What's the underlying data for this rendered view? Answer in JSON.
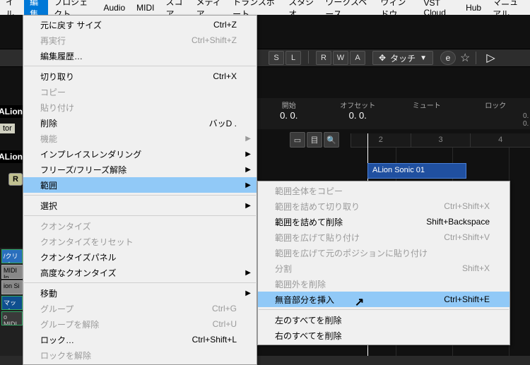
{
  "menubar": {
    "file": "イル",
    "edit": "編集",
    "project": "プロジェクト",
    "audio": "Audio",
    "midi": "MIDI",
    "score": "スコア",
    "media": "メディア",
    "transport": "トランスポート",
    "studio": "スタジオ",
    "workspace": "ワークスペース",
    "window": "ウィンドウ",
    "vstcloud": "VST Cloud",
    "hub": "Hub",
    "manual": "マニュアル"
  },
  "toolbar": {
    "S": "S",
    "L": "L",
    "R": "R",
    "W": "W",
    "A": "A",
    "touch": "タッチ",
    "e_icon": "e",
    "star": "☆"
  },
  "info": {
    "start_lbl": "開始",
    "start_val": "0.  0.",
    "offset_lbl": "オフセット",
    "offset_val": "0.  0.",
    "mute_lbl": "ミュート",
    "mute_val": "",
    "lock_lbl": "ロック",
    "lock_val": "",
    "sub": "0.  0."
  },
  "tracks": {
    "name1": "ALion",
    "tor": "tor",
    "name2": "ALion",
    "r": "R",
    "clip": "ALion Sonic 01"
  },
  "ruler": {
    "t2": "2",
    "t3": "3",
    "t4": "4"
  },
  "icorow": {
    "a": "▭",
    "b": "目",
    "c": "🔍"
  },
  "gutter": {
    "g1": "/クリプ",
    "g2": "MIDI In",
    "g3": "ion Si",
    "g4": "マップ",
    "g5": "o MIDI"
  },
  "menu1": {
    "items": [
      {
        "label": "元に戻す サイズ",
        "shortcut": "Ctrl+Z",
        "disabled": false
      },
      {
        "label": "再実行",
        "shortcut": "Ctrl+Shift+Z",
        "disabled": true
      },
      {
        "label": "編集履歴…",
        "disabled": false
      },
      "---",
      {
        "label": "切り取り",
        "shortcut": "Ctrl+X",
        "disabled": false
      },
      {
        "label": "コピー",
        "disabled": true
      },
      {
        "label": "貼り付け",
        "disabled": true
      },
      {
        "label": "削除",
        "shortcut": "バッD .",
        "disabled": false
      },
      {
        "label": "機能",
        "submenu": true,
        "disabled": true
      },
      {
        "label": "インプレイスレンダリング",
        "submenu": true,
        "disabled": false
      },
      {
        "label": "フリーズ/フリーズ解除",
        "submenu": true,
        "disabled": false
      },
      {
        "label": "範囲",
        "submenu": true,
        "disabled": false,
        "highlight": true
      },
      "---",
      {
        "label": "選択",
        "submenu": true,
        "disabled": false
      },
      "---",
      {
        "label": "クオンタイズ",
        "disabled": true
      },
      {
        "label": "クオンタイズをリセット",
        "disabled": true
      },
      {
        "label": "クオンタイズパネル",
        "disabled": false
      },
      {
        "label": "高度なクオンタイズ",
        "submenu": true,
        "disabled": false
      },
      "---",
      {
        "label": "移動",
        "submenu": true,
        "disabled": false
      },
      {
        "label": "グループ",
        "shortcut": "Ctrl+G",
        "disabled": true
      },
      {
        "label": "グループを解除",
        "shortcut": "Ctrl+U",
        "disabled": true
      },
      {
        "label": "ロック…",
        "shortcut": "Ctrl+Shift+L",
        "disabled": false
      },
      {
        "label": "ロックを解除",
        "disabled": true
      }
    ]
  },
  "menu2": {
    "items": [
      {
        "label": "範囲全体をコピー",
        "disabled": true
      },
      {
        "label": "範囲を詰めて切り取り",
        "shortcut": "Ctrl+Shift+X",
        "disabled": true
      },
      {
        "label": "範囲を詰めて削除",
        "shortcut": "Shift+Backspace",
        "disabled": false
      },
      {
        "label": "範囲を広げて貼り付け",
        "shortcut": "Ctrl+Shift+V",
        "disabled": true
      },
      {
        "label": "範囲を広げて元のポジションに貼り付け",
        "disabled": true
      },
      {
        "label": "分割",
        "shortcut": "Shift+X",
        "disabled": true
      },
      {
        "label": "範囲外を削除",
        "disabled": true
      },
      {
        "label": "無音部分を挿入",
        "shortcut": "Ctrl+Shift+E",
        "disabled": false,
        "highlight": true
      },
      "---",
      {
        "label": "左のすべてを削除",
        "disabled": false
      },
      {
        "label": "右のすべてを削除",
        "disabled": false
      }
    ]
  }
}
